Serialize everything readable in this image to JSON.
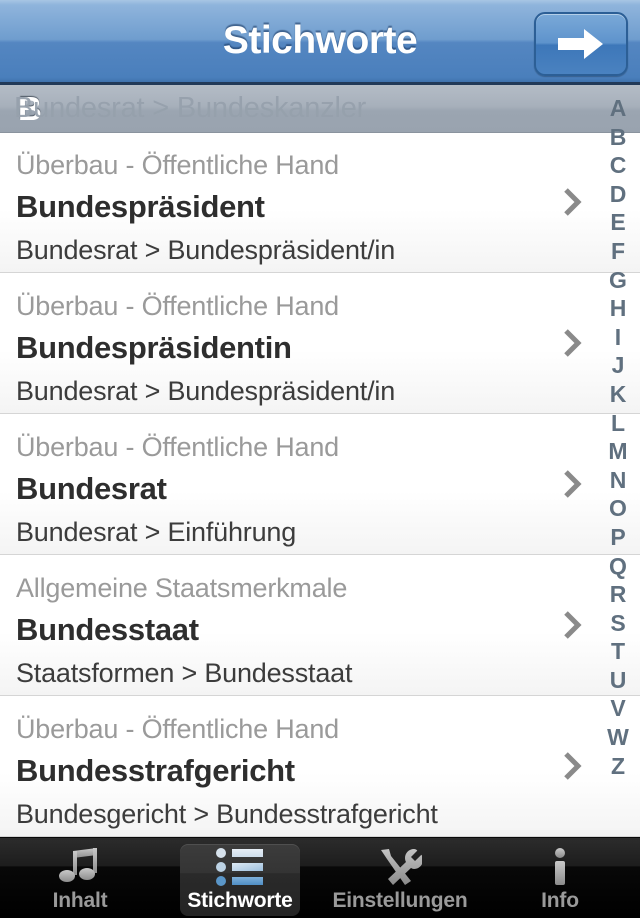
{
  "navbar": {
    "title": "Stichworte",
    "forward_button_icon": "arrow-right-icon"
  },
  "section": {
    "header_letter": "B",
    "ghost_row_text": "Bundesrat > Bundeskanzler"
  },
  "list": {
    "rows": [
      {
        "category": "Überbau - Öffentliche Hand",
        "title": "Bundespräsident",
        "path": "Bundesrat > Bundespräsident/in"
      },
      {
        "category": "Überbau - Öffentliche Hand",
        "title": "Bundespräsidentin",
        "path": "Bundesrat > Bundespräsident/in"
      },
      {
        "category": "Überbau - Öffentliche Hand",
        "title": "Bundesrat",
        "path": "Bundesrat > Einführung"
      },
      {
        "category": "Allgemeine Staatsmerkmale",
        "title": "Bundesstaat",
        "path": "Staatsformen > Bundesstaat"
      },
      {
        "category": "Überbau - Öffentliche Hand",
        "title": "Bundesstrafgericht",
        "path": "Bundesgericht > Bundesstrafgericht"
      }
    ]
  },
  "index_bar": {
    "letters": [
      "A",
      "B",
      "C",
      "D",
      "E",
      "F",
      "G",
      "H",
      "I",
      "J",
      "K",
      "L",
      "M",
      "N",
      "O",
      "P",
      "Q",
      "R",
      "S",
      "T",
      "U",
      "V",
      "W",
      "Z"
    ]
  },
  "tabbar": {
    "tabs": [
      {
        "label": "Inhalt",
        "icon": "music-note-icon",
        "active": false
      },
      {
        "label": "Stichworte",
        "icon": "bulleted-list-icon",
        "active": true
      },
      {
        "label": "Einstellungen",
        "icon": "tools-icon",
        "active": false
      },
      {
        "label": "Info",
        "icon": "info-icon",
        "active": false
      }
    ]
  },
  "colors": {
    "navbar_blue": "#5486c1",
    "section_header_gray": "#a7b0bb",
    "index_letter": "#60707f",
    "title_text": "#2e2e2e",
    "category_text": "#9a9a9a",
    "tabbar_black": "#000000",
    "tab_active_text": "#ffffff"
  }
}
